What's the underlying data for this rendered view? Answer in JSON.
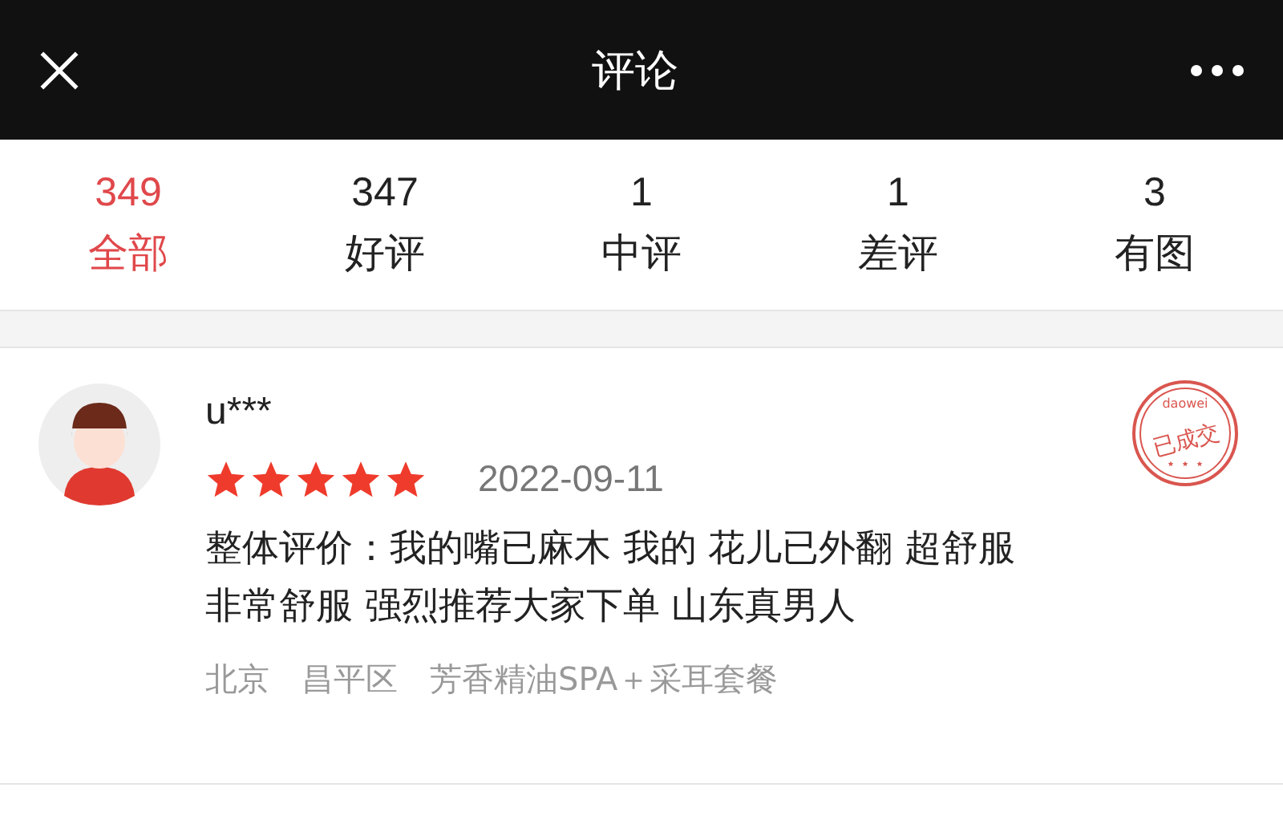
{
  "header": {
    "title": "评论"
  },
  "tabs": [
    {
      "count": "349",
      "label": "全部",
      "selected": true
    },
    {
      "count": "347",
      "label": "好评",
      "selected": false
    },
    {
      "count": "1",
      "label": "中评",
      "selected": false
    },
    {
      "count": "1",
      "label": "差评",
      "selected": false
    },
    {
      "count": "3",
      "label": "有图",
      "selected": false
    }
  ],
  "reviews": [
    {
      "user": "u***",
      "stars": 5,
      "date": "2022-09-11",
      "text": [
        "整体评价：我的嘴已麻木 我的 花儿已外翻 超舒服",
        "非常舒服 强烈推荐大家下单 山东真男人"
      ],
      "stamp": {
        "top": "daowei",
        "main": "已成交"
      },
      "meta": [
        "北京",
        "昌平区",
        "芳香精油SPA＋采耳套餐"
      ]
    }
  ]
}
